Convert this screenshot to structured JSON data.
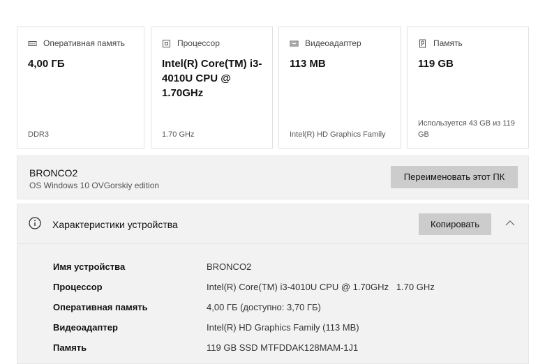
{
  "cards": [
    {
      "title": "Оперативная память",
      "icon": "ram-icon",
      "value": "4,00 ГБ",
      "footer": "DDR3"
    },
    {
      "title": "Процессор",
      "icon": "cpu-icon",
      "value": "Intel(R) Core(TM) i3-4010U CPU @ 1.70GHz",
      "footer": "1.70 GHz"
    },
    {
      "title": "Видеоадаптер",
      "icon": "gpu-icon",
      "value": "113 MB",
      "footer": "Intel(R) HD Graphics Family"
    },
    {
      "title": "Память",
      "icon": "storage-icon",
      "value": "119 GB",
      "footer": "Используется 43 GB из 119 GB"
    }
  ],
  "device": {
    "name": "BRONCO2",
    "os": "OS Windows 10 OVGorskiy edition",
    "rename_label": "Переименовать этот ПК"
  },
  "specs": {
    "title": "Характеристики устройства",
    "copy_label": "Копировать",
    "rows": [
      {
        "key": "Имя устройства",
        "value": "BRONCO2"
      },
      {
        "key": "Процессор",
        "value": "Intel(R) Core(TM) i3-4010U CPU @ 1.70GHz   1.70 GHz"
      },
      {
        "key": "Оперативная память",
        "value": "4,00 ГБ (доступно: 3,70 ГБ)"
      },
      {
        "key": "Видеоадаптер",
        "value": "Intel(R) HD Graphics Family (113 MB)"
      },
      {
        "key": "Память",
        "value": "119 GB SSD MTFDDAK128MAM-1J1"
      }
    ]
  },
  "colors": {
    "button_bg": "#cccccc",
    "panel_bg": "#f2f2f2"
  }
}
